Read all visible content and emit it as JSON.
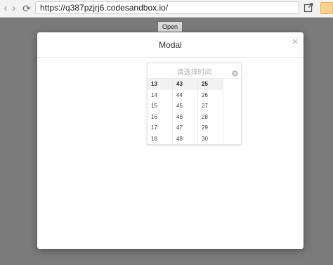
{
  "browser": {
    "url": "https://q387pzjrj6.codesandbox.io/",
    "icons": [
      "back-icon",
      "forward-icon",
      "reload-icon",
      "open-new-window-icon"
    ],
    "extension_color": "#ffd08f"
  },
  "page": {
    "open_button_label": "Open"
  },
  "modal": {
    "title": "Modal",
    "close_icon": "close-icon"
  },
  "time_picker": {
    "placeholder": "请选择时间",
    "clear_icon": "clear-circle-icon",
    "hours": [
      "13",
      "14",
      "15",
      "16",
      "17",
      "18"
    ],
    "minutes": [
      "43",
      "44",
      "45",
      "46",
      "47",
      "48"
    ],
    "seconds": [
      "25",
      "26",
      "27",
      "28",
      "29",
      "30"
    ],
    "selected": {
      "hour": "13",
      "minute": "43",
      "second": "25"
    }
  },
  "colors": {
    "overlay": "#7a7a7a",
    "modal_bg": "#ffffff",
    "selected_row_bg": "#f2f2f2"
  }
}
